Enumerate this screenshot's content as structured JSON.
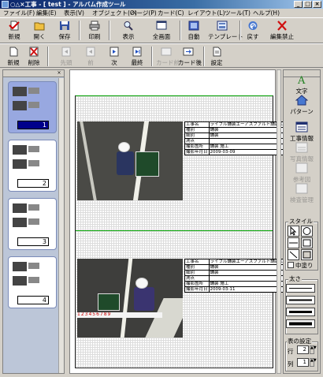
{
  "window": {
    "title": "○△×工事 - [ test ] - アルバム作成ツール",
    "minimize": "_",
    "maximize": "□",
    "close": "×"
  },
  "menu": [
    "ファイル(F)",
    "編集(E)",
    "表示(V)",
    "オブジェクト(O)",
    "ページ(P)",
    "カード(C)",
    "レイアウト(L)",
    "ツール(T)",
    "ヘルプ(H)"
  ],
  "toolbar1": {
    "new": "新規",
    "open": "開く",
    "save": "保存",
    "print": "印刷",
    "view": "表示",
    "fullscreen": "全画面",
    "auto": "自動",
    "template": "テンプレート",
    "undo": "戻す",
    "no_edit": "編集禁止"
  },
  "toolbar2": {
    "new": "新規",
    "delete": "削除",
    "first": "先頭",
    "prev": "前",
    "next": "次",
    "last": "最終",
    "card_before": "カード前",
    "card_after": "カード後",
    "settings": "設定"
  },
  "pages": [
    {
      "number": "1",
      "selected": true
    },
    {
      "number": "2",
      "selected": false
    },
    {
      "number": "3",
      "selected": false
    },
    {
      "number": "4",
      "selected": false
    }
  ],
  "cards": [
    {
      "rows": [
        {
          "key": "工事名",
          "value": "ライフル舗装エーアスファルト舗装工-定着"
        },
        {
          "key": "種別",
          "value": "舗装"
        },
        {
          "key": "細別",
          "value": "舗装"
        },
        {
          "key": "測点",
          "value": ""
        },
        {
          "key": "撮影箇所",
          "value": "舗装 施工"
        },
        {
          "key": "撮影年月日",
          "value": "2009-03-09"
        }
      ]
    },
    {
      "rows": [
        {
          "key": "工事名",
          "value": "ライフル舗装エーアスファルト舗装工-定着"
        },
        {
          "key": "種別",
          "value": "舗装"
        },
        {
          "key": "細別",
          "value": "舗装"
        },
        {
          "key": "測点",
          "value": ""
        },
        {
          "key": "撮影箇所",
          "value": "舗装 施工"
        },
        {
          "key": "撮影年月日",
          "value": "2009-03-11"
        }
      ]
    }
  ],
  "photo2_ruler": "123456789",
  "right_panel": {
    "text": "文字",
    "pattern": "パターン",
    "work_info": "工事情報",
    "photo_info": "写真情報",
    "reference": "参考図",
    "inspection": "検査管理",
    "style_label": "スタイル",
    "fill_label": "中塗り",
    "thickness_label": "太さ",
    "table_settings_label": "表の設定",
    "row_label": "行",
    "row_value": "2",
    "col_label": "列",
    "col_value": "1"
  }
}
